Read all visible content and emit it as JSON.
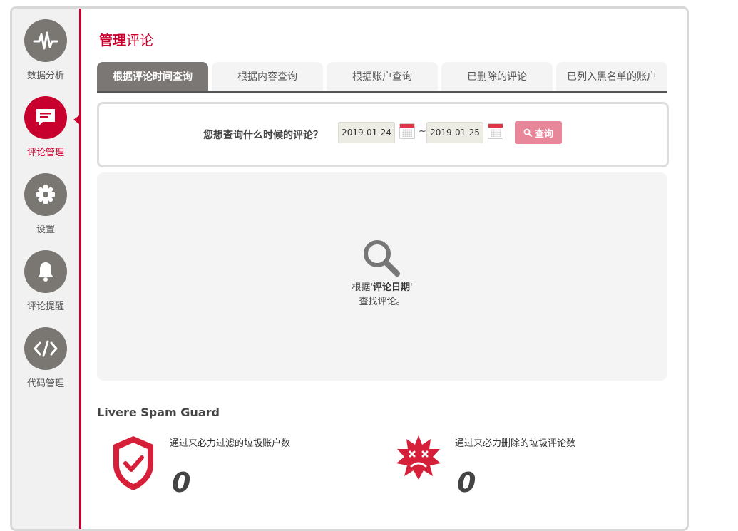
{
  "sidebar": {
    "items": [
      {
        "label": "数据分析",
        "icon": "pulse-icon",
        "active": false
      },
      {
        "label": "评论管理",
        "icon": "comment-icon",
        "active": true
      },
      {
        "label": "设置",
        "icon": "gear-icon",
        "active": false
      },
      {
        "label": "评论提醒",
        "icon": "bell-icon",
        "active": false
      },
      {
        "label": "代码管理",
        "icon": "code-icon",
        "active": false
      }
    ]
  },
  "page": {
    "title_main": "管理",
    "title_sub": "评论"
  },
  "tabs": [
    {
      "label": "根据评论时间查询",
      "active": true
    },
    {
      "label": "根据内容查询",
      "active": false
    },
    {
      "label": "根据账户查询",
      "active": false
    },
    {
      "label": "已删除的评论",
      "active": false
    },
    {
      "label": "已列入黑名单的账户",
      "active": false
    }
  ],
  "query": {
    "label": "您想查询什么时候的评论？",
    "start_date": "2019-01-24",
    "separator": "~",
    "end_date": "2019-01-25",
    "button_label": "查询"
  },
  "results": {
    "hint_prefix": "根据'",
    "hint_bold": "评论日期",
    "hint_suffix": "'",
    "hint_line2": "查找评论。"
  },
  "spam_guard": {
    "title": "Livere Spam Guard",
    "filtered_label": "通过来必力过滤的垃圾账户数",
    "filtered_value": "0",
    "deleted_label": "通过来必力删除的垃圾评论数",
    "deleted_value": "0"
  },
  "colors": {
    "accent": "#c8002e",
    "inactive_icon": "#7a7671",
    "button": "#e8869a"
  }
}
